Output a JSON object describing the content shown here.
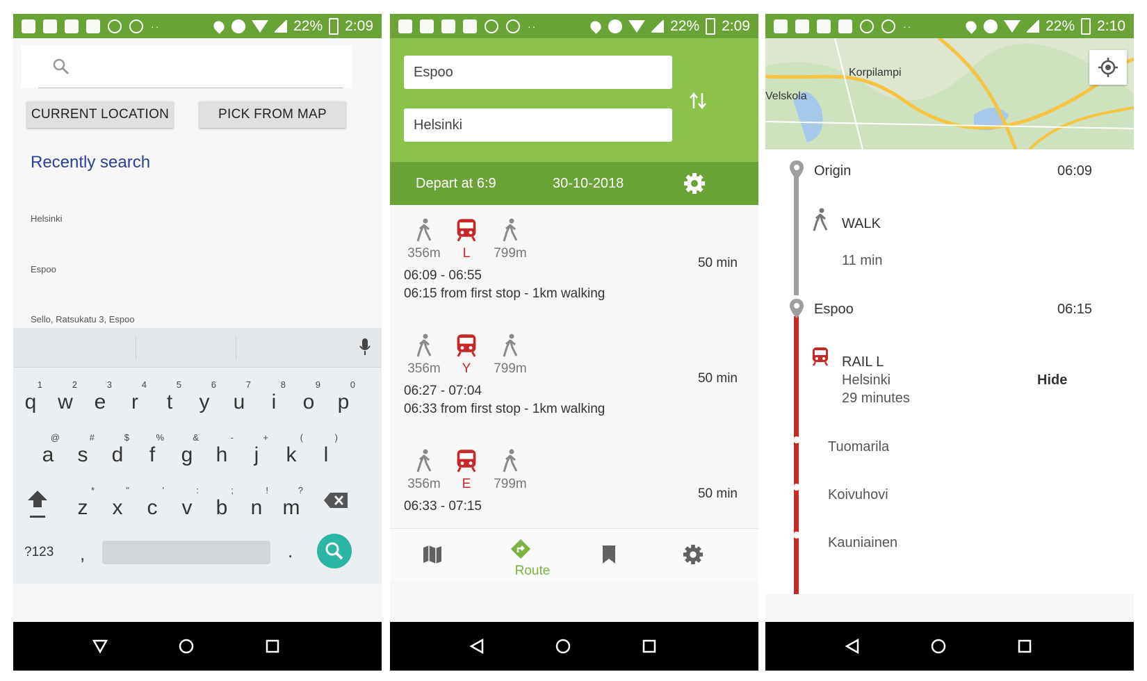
{
  "colors": {
    "status_green": "#6aa335",
    "header_green": "#8bc34a",
    "accent_blue": "#2a3f9e",
    "rail_red": "#c62828",
    "fab_teal": "#2bb5a2"
  },
  "screen1": {
    "status": {
      "battery": "22%",
      "time": "2:09"
    },
    "search": {
      "placeholder": "",
      "icon": "search-icon"
    },
    "buttons": {
      "current_location": "CURRENT LOCATION",
      "pick_from_map": "PICK FROM MAP"
    },
    "recent_title": "Recently search",
    "recent_items": [
      "Helsinki",
      "Espoo",
      "Sello, Ratsukatu 3, Espoo"
    ],
    "keyboard": {
      "row1": [
        {
          "l": "q",
          "h": "1"
        },
        {
          "l": "w",
          "h": "2"
        },
        {
          "l": "e",
          "h": "3"
        },
        {
          "l": "r",
          "h": "4"
        },
        {
          "l": "t",
          "h": "5"
        },
        {
          "l": "y",
          "h": "6"
        },
        {
          "l": "u",
          "h": "7"
        },
        {
          "l": "i",
          "h": "8"
        },
        {
          "l": "o",
          "h": "9"
        },
        {
          "l": "p",
          "h": "0"
        }
      ],
      "row2": [
        {
          "l": "a",
          "h": "@"
        },
        {
          "l": "s",
          "h": "#"
        },
        {
          "l": "d",
          "h": "$"
        },
        {
          "l": "f",
          "h": "%"
        },
        {
          "l": "g",
          "h": "&"
        },
        {
          "l": "h",
          "h": "-"
        },
        {
          "l": "j",
          "h": "+"
        },
        {
          "l": "k",
          "h": "("
        },
        {
          "l": "l",
          "h": ")"
        }
      ],
      "row3": [
        {
          "l": "z",
          "h": "*"
        },
        {
          "l": "x",
          "h": "\""
        },
        {
          "l": "c",
          "h": "'"
        },
        {
          "l": "v",
          "h": ":"
        },
        {
          "l": "b",
          "h": ";"
        },
        {
          "l": "n",
          "h": "!"
        },
        {
          "l": "m",
          "h": "?"
        }
      ],
      "symbols_label": "?123",
      "comma": ",",
      "period": "."
    }
  },
  "screen2": {
    "status": {
      "battery": "22%",
      "time": "2:09"
    },
    "from": "Espoo",
    "to": "Helsinki",
    "depart": "Depart at 6:9",
    "date": "30-10-2018",
    "routes": [
      {
        "walk1": "356m",
        "line": "L",
        "walk2": "799m",
        "times": "06:09 - 06:55",
        "detail": "06:15 from first stop - 1km walking",
        "duration": "50 min"
      },
      {
        "walk1": "356m",
        "line": "Y",
        "walk2": "799m",
        "times": "06:27 - 07:04",
        "detail": "06:33 from first stop - 1km walking",
        "duration": "50 min"
      },
      {
        "walk1": "356m",
        "line": "E",
        "walk2": "799m",
        "times": "06:33 - 07:15",
        "detail": "",
        "duration": "50 min"
      }
    ],
    "tabs": {
      "active_label": "Route"
    }
  },
  "screen3": {
    "status": {
      "battery": "22%",
      "time": "2:10"
    },
    "map_labels": {
      "a": "Korpilampi",
      "b": "Velskola"
    },
    "origin": {
      "name": "Origin",
      "time": "06:09"
    },
    "walk": {
      "label": "WALK",
      "duration": "11 min"
    },
    "espoo": {
      "name": "Espoo",
      "time": "06:15"
    },
    "rail": {
      "label": "RAIL L",
      "dest": "Helsinki",
      "duration": "29 minutes",
      "hide": "Hide"
    },
    "stops": [
      "Tuomarila",
      "Koivuhovi",
      "Kauniainen"
    ]
  }
}
